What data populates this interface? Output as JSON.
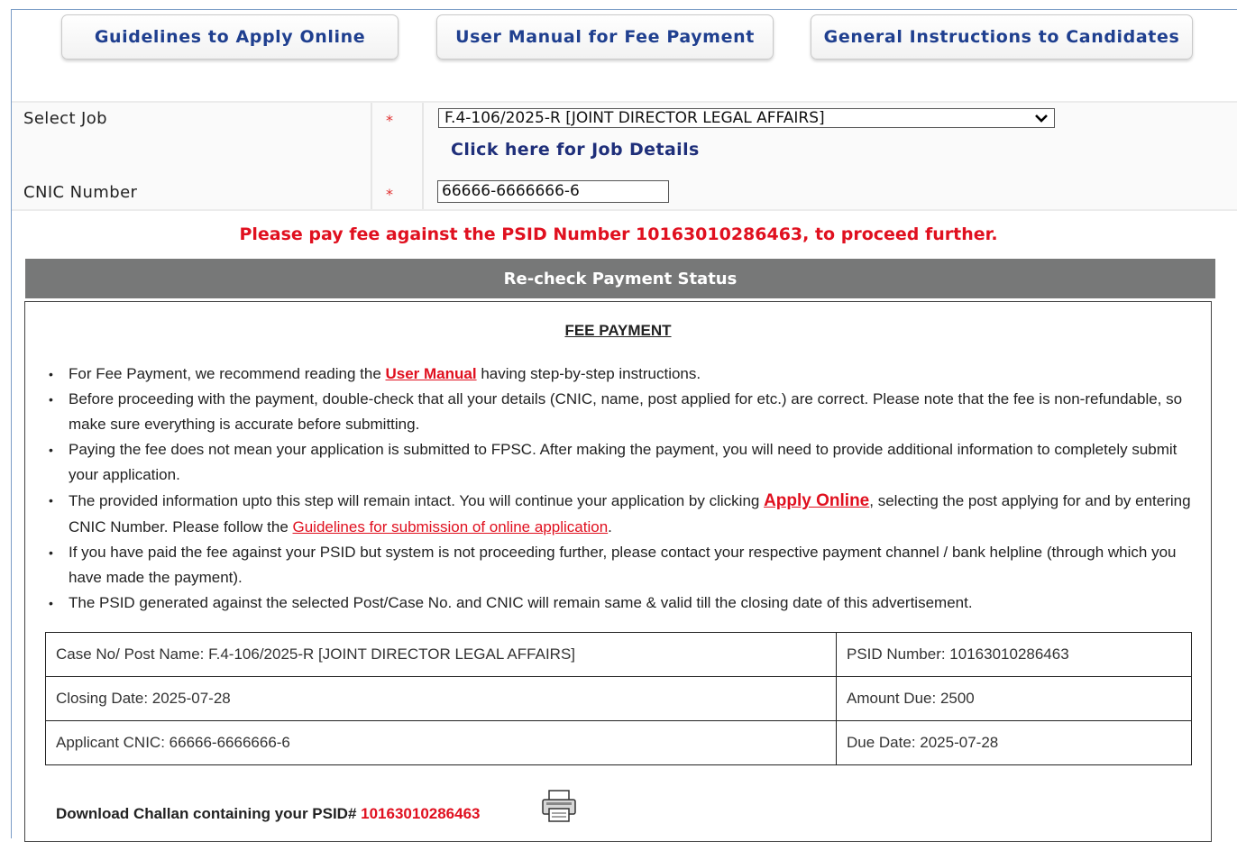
{
  "top_buttons": {
    "guidelines": "Guidelines to Apply Online",
    "user_manual": "User Manual for Fee Payment",
    "general_instructions": "General Instructions to Candidates"
  },
  "form": {
    "select_job_label": "Select Job",
    "select_job_value": "F.4-106/2025-R [JOINT DIRECTOR LEGAL AFFAIRS]",
    "job_details_link": "Click here for Job Details",
    "cnic_label": "CNIC Number",
    "cnic_value": "66666-6666666-6",
    "required_mark": "*"
  },
  "alert": "Please pay fee against the PSID Number 10163010286463, to proceed further.",
  "recheck_button": "Re-check Payment Status",
  "fee": {
    "title": "FEE PAYMENT",
    "i1_a": "For Fee Payment, we recommend reading the ",
    "i1_link": "User Manual",
    "i1_b": " having step-by-step instructions.",
    "i2": "Before proceeding with the payment, double-check that all your details (CNIC, name, post applied for etc.) are correct. Please note that the fee is non-refundable, so make sure everything is accurate before submitting.",
    "i3": "Paying the fee does not mean your application is submitted to FPSC. After making the payment, you will need to provide additional information to completely submit your application.",
    "i4_a": "The provided information upto this step will remain intact. You will continue your application by clicking ",
    "i4_link1": "Apply Online",
    "i4_b": ", selecting the post applying for and by entering CNIC Number. Please follow the ",
    "i4_link2": "Guidelines for submission of online application",
    "i4_c": ".",
    "i5": "If you have paid the fee against your PSID but system is not proceeding further, please contact your respective payment channel / bank helpline (through which you have made the payment).",
    "i6": "The PSID generated against the selected Post/Case No. and CNIC will remain same & valid till the closing date of this advertisement."
  },
  "table": {
    "case_no": "Case No/ Post Name: F.4-106/2025-R [JOINT DIRECTOR LEGAL AFFAIRS]",
    "psid": "PSID Number: 10163010286463",
    "closing_date": "Closing Date: 2025-07-28",
    "amount_due": "Amount Due: 2500",
    "applicant_cnic": "Applicant CNIC: 66666-6666666-6",
    "due_date": "Due Date: 2025-07-28"
  },
  "download": {
    "text": "Download Challan containing your PSID# ",
    "psid": "10163010286463"
  },
  "icons": {
    "printer": "printer-icon",
    "dropdown": "chevron-down-icon"
  }
}
